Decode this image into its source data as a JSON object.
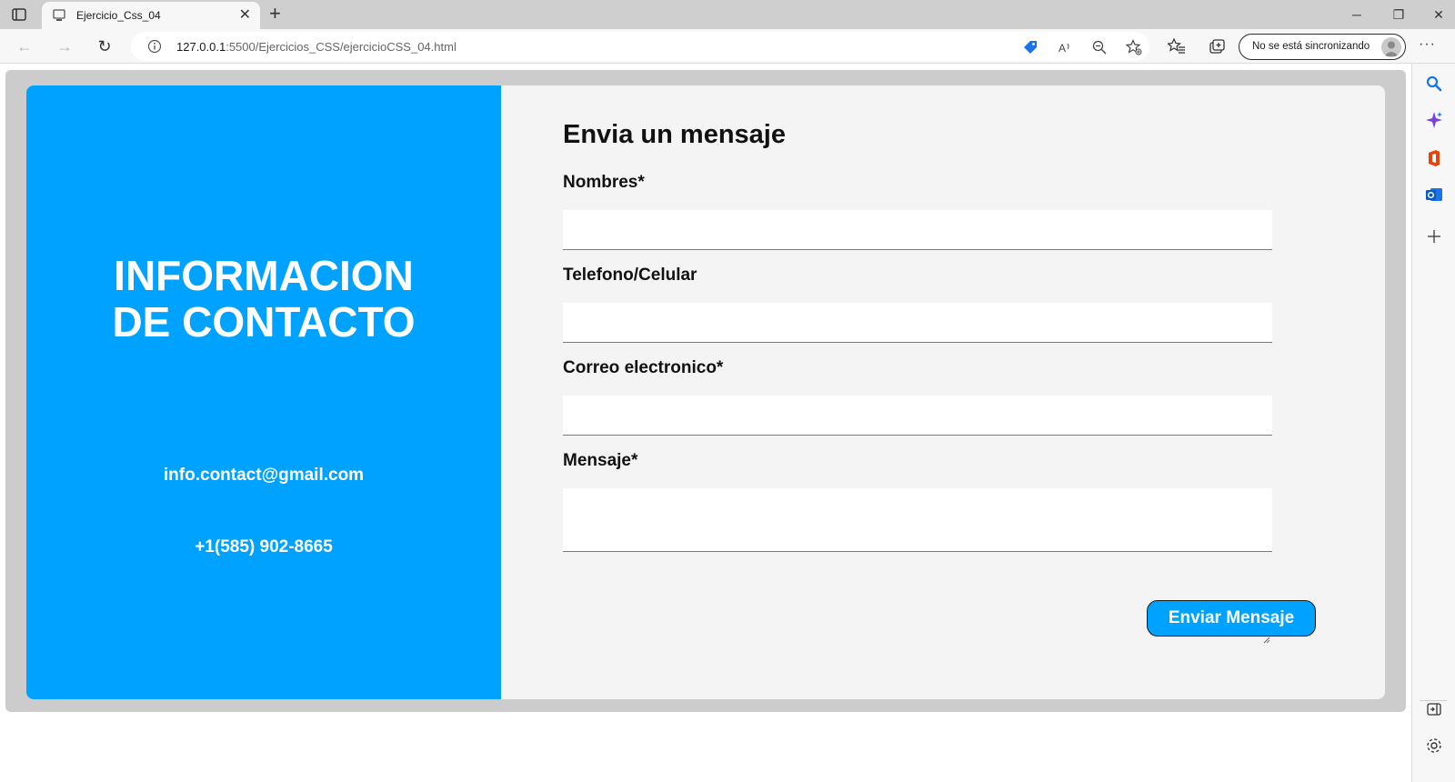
{
  "browser": {
    "tab_title": "Ejercicio_Css_04",
    "url_host": "127.0.0.1",
    "url_rest": ":5500/Ejercicios_CSS/ejercicioCSS_04.html",
    "sync_label": "No se está sincronizando"
  },
  "contact_info": {
    "title_line1": "INFORMACION",
    "title_line2": "DE CONTACTO",
    "email": "info.contact@gmail.com",
    "phone": "+1(585) 902-8665"
  },
  "form": {
    "title": "Envia un mensaje",
    "fields": [
      {
        "label": "Nombres*",
        "value": ""
      },
      {
        "label": "Telefono/Celular",
        "value": ""
      },
      {
        "label": "Correo electronico*",
        "value": ""
      },
      {
        "label": "Mensaje*",
        "value": ""
      }
    ],
    "submit_label": "Enviar Mensaje"
  },
  "colors": {
    "accent": "#00a2ff",
    "card_bg": "#f4f4f4",
    "outer_bg": "#cccccc"
  }
}
